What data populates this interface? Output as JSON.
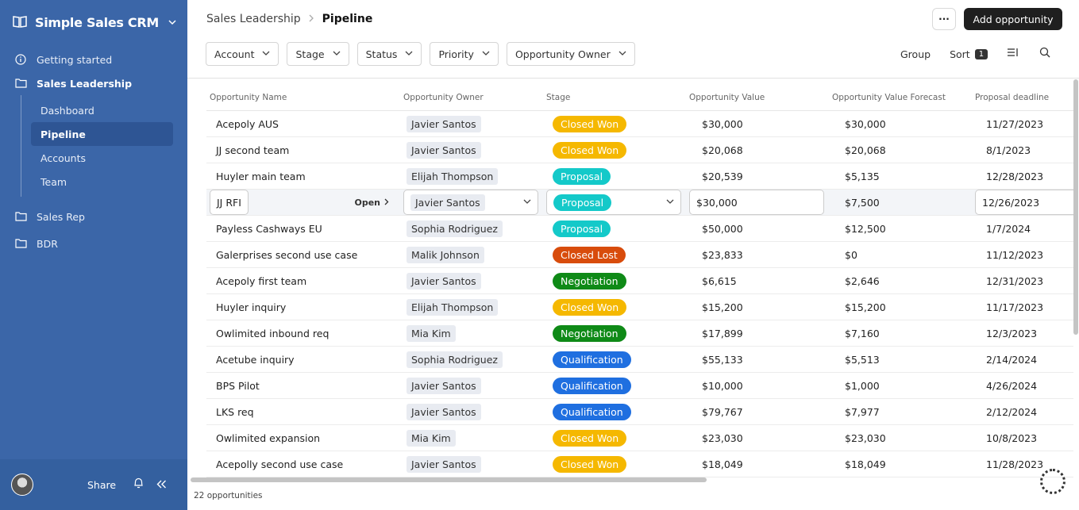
{
  "sidebar": {
    "workspace_title": "Simple Sales CRM",
    "items": [
      {
        "label": "Getting started"
      },
      {
        "label": "Sales Leadership"
      }
    ],
    "subitems": [
      {
        "label": "Dashboard"
      },
      {
        "label": "Pipeline"
      },
      {
        "label": "Accounts"
      },
      {
        "label": "Team"
      }
    ],
    "other_items": [
      {
        "label": "Sales Rep"
      },
      {
        "label": "BDR"
      }
    ],
    "share_label": "Share",
    "accent_color": "#3b66a8"
  },
  "header": {
    "breadcrumb_parent": "Sales Leadership",
    "breadcrumb_current": "Pipeline",
    "more_label": "···",
    "add_label": "Add opportunity"
  },
  "filters": [
    "Account",
    "Stage",
    "Status",
    "Priority",
    "Opportunity Owner"
  ],
  "toolbar": {
    "group_label": "Group",
    "sort_label": "Sort",
    "sort_count": "1"
  },
  "table": {
    "columns": [
      "Opportunity Name",
      "Opportunity Owner",
      "Stage",
      "Opportunity Value",
      "Opportunity Value Forecast",
      "Proposal deadline"
    ],
    "open_label": "Open",
    "rows": [
      {
        "name": "Acepoly AUS",
        "owner": "Javier Santos",
        "stage": "Closed Won",
        "value": "$30,000",
        "forecast": "$30,000",
        "deadline": "11/27/2023"
      },
      {
        "name": "JJ second team",
        "owner": "Javier Santos",
        "stage": "Closed Won",
        "value": "$20,068",
        "forecast": "$20,068",
        "deadline": "8/1/2023"
      },
      {
        "name": "Huyler main team",
        "owner": "Elijah Thompson",
        "stage": "Proposal",
        "value": "$20,539",
        "forecast": "$5,135",
        "deadline": "12/28/2023"
      },
      {
        "name": "JJ RFI",
        "owner": "Javier Santos",
        "stage": "Proposal",
        "value": "$30,000",
        "forecast": "$7,500",
        "deadline": "12/26/2023"
      },
      {
        "name": "Payless Cashways EU",
        "owner": "Sophia Rodriguez",
        "stage": "Proposal",
        "value": "$50,000",
        "forecast": "$12,500",
        "deadline": "1/7/2024"
      },
      {
        "name": "Galerprises second use case",
        "owner": "Malik Johnson",
        "stage": "Closed Lost",
        "value": "$23,833",
        "forecast": "$0",
        "deadline": "11/12/2023"
      },
      {
        "name": "Acepoly first team",
        "owner": "Javier Santos",
        "stage": "Negotiation",
        "value": "$6,615",
        "forecast": "$2,646",
        "deadline": "12/31/2023"
      },
      {
        "name": "Huyler inquiry",
        "owner": "Elijah Thompson",
        "stage": "Closed Won",
        "value": "$15,200",
        "forecast": "$15,200",
        "deadline": "11/17/2023"
      },
      {
        "name": "Owlimited inbound req",
        "owner": "Mia Kim",
        "stage": "Negotiation",
        "value": "$17,899",
        "forecast": "$7,160",
        "deadline": "12/3/2023"
      },
      {
        "name": "Acetube inquiry",
        "owner": "Sophia Rodriguez",
        "stage": "Qualification",
        "value": "$55,133",
        "forecast": "$5,513",
        "deadline": "2/14/2024"
      },
      {
        "name": "BPS Pilot",
        "owner": "Javier Santos",
        "stage": "Qualification",
        "value": "$10,000",
        "forecast": "$1,000",
        "deadline": "4/26/2024"
      },
      {
        "name": "LKS req",
        "owner": "Javier Santos",
        "stage": "Qualification",
        "value": "$79,767",
        "forecast": "$7,977",
        "deadline": "2/12/2024"
      },
      {
        "name": "Owlimited expansion",
        "owner": "Mia Kim",
        "stage": "Closed Won",
        "value": "$23,030",
        "forecast": "$23,030",
        "deadline": "10/8/2023"
      },
      {
        "name": "Acepolly second use case",
        "owner": "Javier Santos",
        "stage": "Closed Won",
        "value": "$18,049",
        "forecast": "$18,049",
        "deadline": "11/28/2023"
      }
    ],
    "hover_row_index": 3,
    "stage_colors": {
      "Closed Won": "#f5b800",
      "Proposal": "#14c9c9",
      "Closed Lost": "#d84c0c",
      "Negotiation": "#0f8a17",
      "Qualification": "#1f6fe0"
    }
  },
  "footer": {
    "count_label": "22 opportunities"
  }
}
